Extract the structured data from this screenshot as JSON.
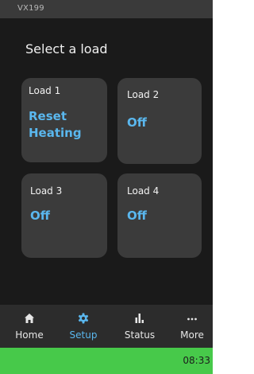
{
  "status_bar": {
    "device_name": "VX199"
  },
  "page": {
    "title": "Select a load"
  },
  "loads": [
    {
      "name": "Load 1",
      "status": "Reset Heating"
    },
    {
      "name": "Load 2",
      "status": "Off"
    },
    {
      "name": "Load 3",
      "status": "Off"
    },
    {
      "name": "Load 4",
      "status": "Off"
    }
  ],
  "nav": {
    "items": [
      {
        "label": "Home",
        "icon": "home-icon"
      },
      {
        "label": "Setup",
        "icon": "gear-icon",
        "active": true
      },
      {
        "label": "Status",
        "icon": "bar-chart-icon"
      },
      {
        "label": "More",
        "icon": "more-dots-icon"
      }
    ]
  },
  "footer": {
    "time": "08:33"
  },
  "colors": {
    "accent": "#5ab7ee",
    "footer": "#47c94a",
    "background": "#1a1a1a",
    "tile": "#3b3b3b",
    "nav": "#2c2c2c"
  }
}
